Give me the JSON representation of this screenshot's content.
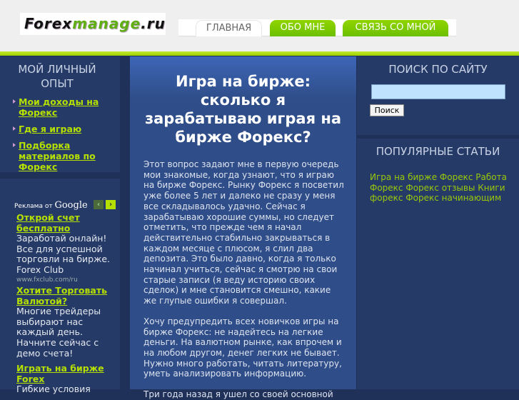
{
  "logo": {
    "part1": "Forex",
    "part2": "manage",
    "part3": ".ru"
  },
  "nav": {
    "tabs": [
      {
        "label": "ГЛАВНАЯ"
      },
      {
        "label": "ОБО МНЕ"
      },
      {
        "label": "СВЯЗЬ СО МНОЙ"
      }
    ]
  },
  "left": {
    "title": "МОЙ ЛИЧНЫЙ ОПЫТ",
    "links": [
      "Мои доходы на Форекс",
      "Где я играю",
      "Подборка материалов по Форекс"
    ]
  },
  "ads": {
    "label": "Реклама от",
    "brand": "Google",
    "items": [
      {
        "title": "Открой счет бесплатно",
        "text": "Заработай онлайн! Все для успешной торговли на бирже. Forex Club",
        "url": "www.fxclub.com/ru"
      },
      {
        "title": "Хотите Торговать Валютой?",
        "text": "Многие трейдеры выбирают нас каждый день. Начните сейчас с демо счета!"
      },
      {
        "title": "Играть на бирже Forex",
        "text": "Гибкие условия"
      }
    ]
  },
  "main": {
    "title": "Игра на бирже: сколько я зарабатываю играя на бирже Форекс?",
    "paragraphs": [
      "Этот вопрос задают мне в первую очередь мои знакомые, когда узнают, что я играю на бирже Форекс. Рынку Форекс я посветил уже более 5 лет и далеко не сразу у меня все складывалось удачно. Сейчас я зарабатываю хорошие суммы, но следует отметить, что прежде чем я начал действительно стабильно закрываться в каждом месяце с плюсом, я слил два депозита. Это было давно, когда я только начинал учиться, сейчас я смотрю на свои старые записи (я веду историю своих сделок) и мне становится смешно, какие же глупые ошибки я совершал.",
      "Хочу предупредить всех новичков игры на бирже Форекс: не надейтесь на легкие деньги. На валютном рынке, как впрочем и на любом другом, денег легких не бывает. Нужно много работать, читать литературу, уметь анализировать информацию.",
      "Три года назад я ушел со своей основной"
    ]
  },
  "search": {
    "title": "ПОИСК ПО САЙТУ",
    "value": "",
    "button": "Поиск"
  },
  "popular": {
    "title": "ПОПУЛЯРНЫЕ СТАТЬИ",
    "links": [
      "Игра на бирже Форекс",
      "Работа Форекс",
      "Форекс отзывы",
      "Книги форекс",
      "Форекс начинающим"
    ]
  }
}
